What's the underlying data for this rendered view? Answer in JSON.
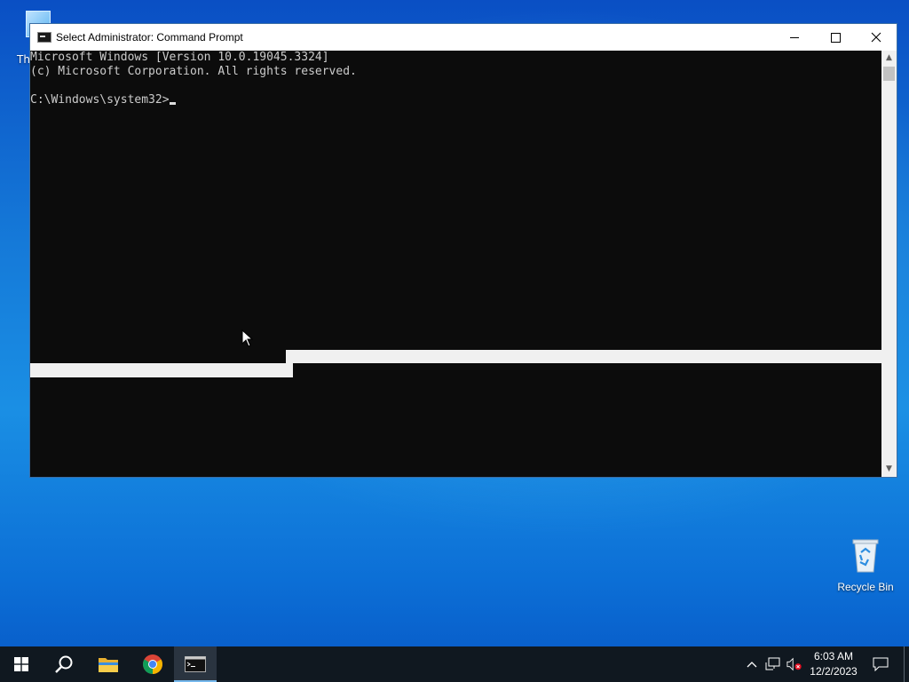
{
  "desktop": {
    "partial_icon_label": "Th",
    "recycle_bin_label": "Recycle Bin"
  },
  "window": {
    "title": "Select Administrator: Command Prompt",
    "console_lines": [
      "Microsoft Windows [Version 10.0.19045.3324]",
      "(c) Microsoft Corporation. All rights reserved.",
      "",
      "C:\\Windows\\system32>"
    ]
  },
  "taskbar": {
    "items": [
      "start-button",
      "search-button",
      "file-explorer",
      "chrome",
      "command-prompt"
    ],
    "clock_time": "6:03 AM",
    "clock_date": "12/2/2023"
  },
  "colors": {
    "console_bg": "#0c0c0c",
    "console_fg": "#cccccc",
    "taskbar_bg": "#101820",
    "accent": "#76b9ed"
  }
}
